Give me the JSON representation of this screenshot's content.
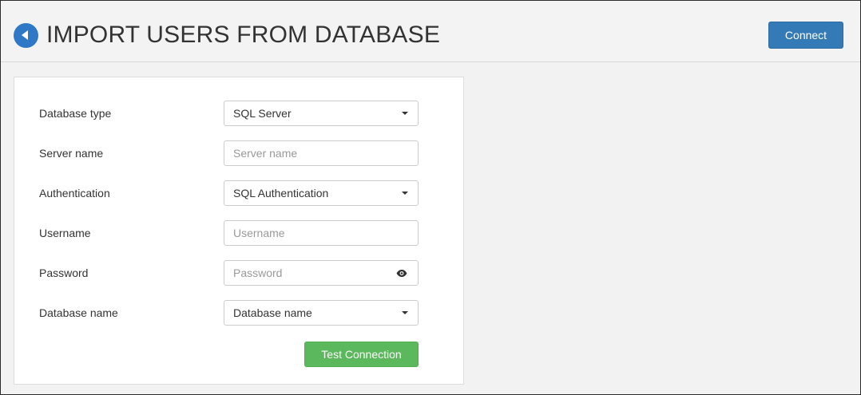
{
  "header": {
    "title": "IMPORT USERS FROM DATABASE",
    "back_icon": "back-arrow-icon",
    "connect_label": "Connect"
  },
  "form": {
    "fields": [
      {
        "label": "Database type",
        "type": "select",
        "value": "SQL Server",
        "placeholder": ""
      },
      {
        "label": "Server name",
        "type": "input",
        "value": "",
        "placeholder": "Server name"
      },
      {
        "label": "Authentication",
        "type": "select",
        "value": "SQL Authentication",
        "placeholder": ""
      },
      {
        "label": "Username",
        "type": "input",
        "value": "",
        "placeholder": "Username"
      },
      {
        "label": "Password",
        "type": "password",
        "value": "",
        "placeholder": "Password",
        "icon": "eye-icon"
      },
      {
        "label": "Database name",
        "type": "select",
        "value": "Database name",
        "placeholder": ""
      }
    ],
    "test_connection_label": "Test Connection"
  },
  "colors": {
    "primary": "#337ab7",
    "success": "#5cb85c",
    "back_button": "#2f78c6"
  }
}
